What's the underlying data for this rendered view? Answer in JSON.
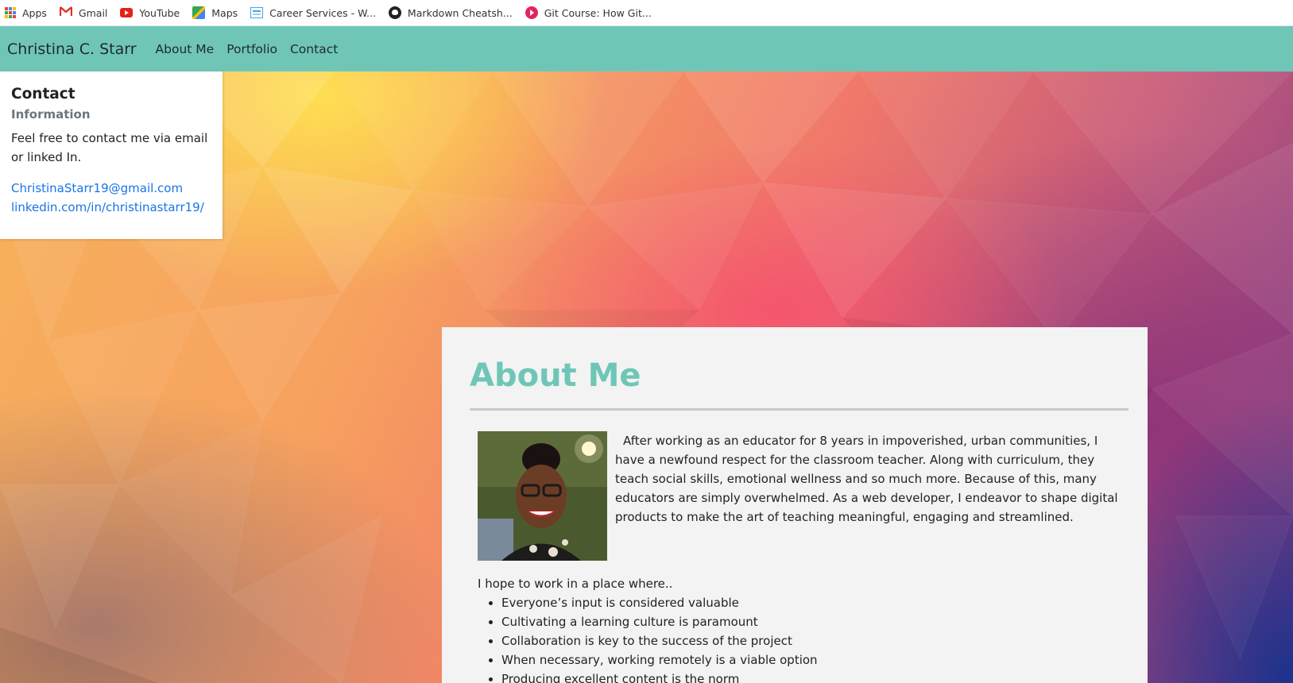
{
  "bookmarks": [
    {
      "label": "Apps",
      "icon": "apps-grid-icon"
    },
    {
      "label": "Gmail",
      "icon": "gmail-icon"
    },
    {
      "label": "YouTube",
      "icon": "youtube-icon"
    },
    {
      "label": "Maps",
      "icon": "maps-icon"
    },
    {
      "label": "Career Services - W...",
      "icon": "career-services-icon"
    },
    {
      "label": "Markdown Cheatsh...",
      "icon": "github-icon"
    },
    {
      "label": "Git Course: How Git...",
      "icon": "git-course-icon"
    }
  ],
  "navbar": {
    "brand": "Christina C. Starr",
    "links": [
      "About Me",
      "Portfolio",
      "Contact"
    ],
    "color": "#6fc6b7"
  },
  "contact": {
    "title": "Contact",
    "subtitle": "Information",
    "text": "Feel free to contact me via email or linked In.",
    "email": "ChristinaStarr19@gmail.com",
    "linkedin": "linkedin.com/in/christinastarr19/"
  },
  "about": {
    "title": "About Me",
    "paragraph": "After working as an educator for 8 years in impoverished, urban communities, I have a newfound respect for the classroom teacher. Along with curriculum, they teach social skills, emotional wellness and so much more. Because of this, many educators are simply overwhelmed. As a web developer, I endeavor to shape digital products to make the art of teaching meaningful, engaging and streamlined.",
    "hope_intro": "I hope to work in a place where..",
    "values": [
      "Everyone’s input is considered valuable",
      "Cultivating a learning culture is paramount",
      "Collaboration is key to the success of the project",
      "When necessary, working remotely is a viable option",
      "Producing excellent content is the norm"
    ],
    "accent_color": "#6fc6b7"
  }
}
